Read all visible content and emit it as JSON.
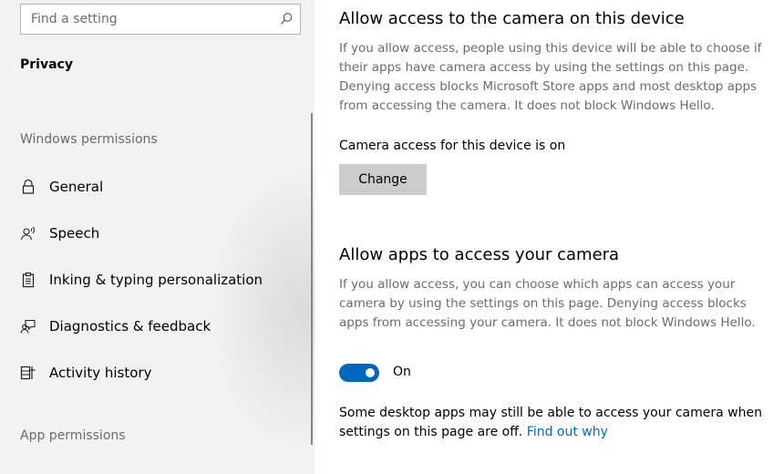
{
  "sidebar": {
    "search": {
      "placeholder": "Find a setting",
      "icon": "search-icon"
    },
    "section_title": "Privacy",
    "groups": {
      "windows_permissions": "Windows permissions",
      "app_permissions": "App permissions"
    },
    "items": [
      {
        "label": "General",
        "icon": "lock-icon"
      },
      {
        "label": "Speech",
        "icon": "speech-icon"
      },
      {
        "label": "Inking & typing personalization",
        "icon": "clipboard-icon"
      },
      {
        "label": "Diagnostics & feedback",
        "icon": "feedback-icon"
      },
      {
        "label": "Activity history",
        "icon": "activity-icon"
      }
    ]
  },
  "main": {
    "device_section": {
      "title": "Allow access to the camera on this device",
      "description": "If you allow access, people using this device will be able to choose if their apps have camera access by using the settings on this page. Denying access blocks Microsoft Store apps and most desktop apps from accessing the camera. It does not block Windows Hello.",
      "status": "Camera access for this device is on",
      "change_label": "Change"
    },
    "apps_section": {
      "title": "Allow apps to access your camera",
      "description": "If you allow access, you can choose which apps can access your camera by using the settings on this page. Denying access blocks apps from accessing your camera. It does not block Windows Hello.",
      "toggle_state": "On",
      "toggle_on": true,
      "note_text": "Some desktop apps may still be able to access your camera when settings on this page are off. ",
      "note_link": "Find out why"
    }
  },
  "colors": {
    "accent": "#0067c0",
    "sidebar_bg": "#f2f2f2",
    "secondary_text": "#6b6b6b",
    "button_bg": "#cccccc"
  }
}
